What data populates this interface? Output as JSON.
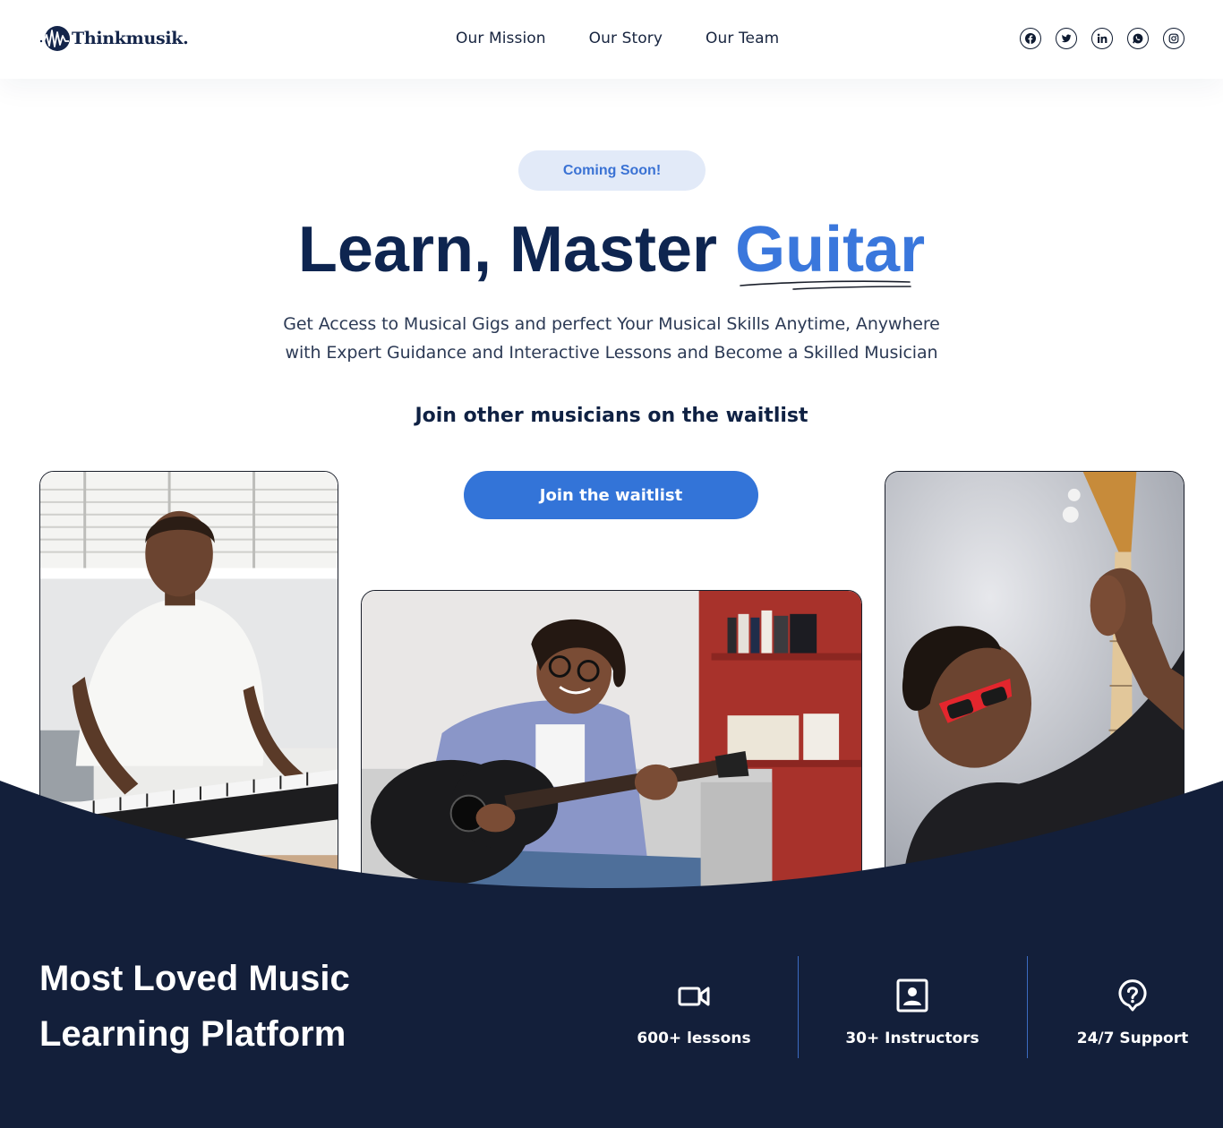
{
  "header": {
    "logo_text": "Thinkmusik.",
    "nav": [
      "Our Mission",
      "Our Story",
      "Our Team"
    ],
    "socials": [
      "facebook-icon",
      "twitter-icon",
      "linkedin-icon",
      "whatsapp-icon",
      "instagram-icon"
    ]
  },
  "hero": {
    "badge": "Coming Soon!",
    "headline_main": "Learn, Master ",
    "headline_accent": "Guitar",
    "subtitle_line1": "Get Access to Musical Gigs and perfect Your Musical Skills Anytime, Anywhere",
    "subtitle_line2": "with Expert Guidance and Interactive Lessons and Become a Skilled Musician",
    "waitlist_heading": "Join other musicians on the waitlist",
    "cta_label": "Join the waitlist"
  },
  "photos": [
    {
      "name": "pianist-photo"
    },
    {
      "name": "guitarist-photo"
    },
    {
      "name": "bassist-photo"
    }
  ],
  "stats_section": {
    "title_line1": "Most Loved Music",
    "title_line2": "Learning Platform",
    "stats": [
      {
        "icon": "video-camera-icon",
        "label": "600+ lessons"
      },
      {
        "icon": "instructor-icon",
        "label": "30+ Instructors"
      },
      {
        "icon": "support-question-icon",
        "label": "24/7 Support"
      }
    ]
  },
  "colors": {
    "brand_navy": "#0e2550",
    "accent_blue": "#3a77dc",
    "dark_section": "#131f3a",
    "badge_bg": "#e2eaf8"
  }
}
